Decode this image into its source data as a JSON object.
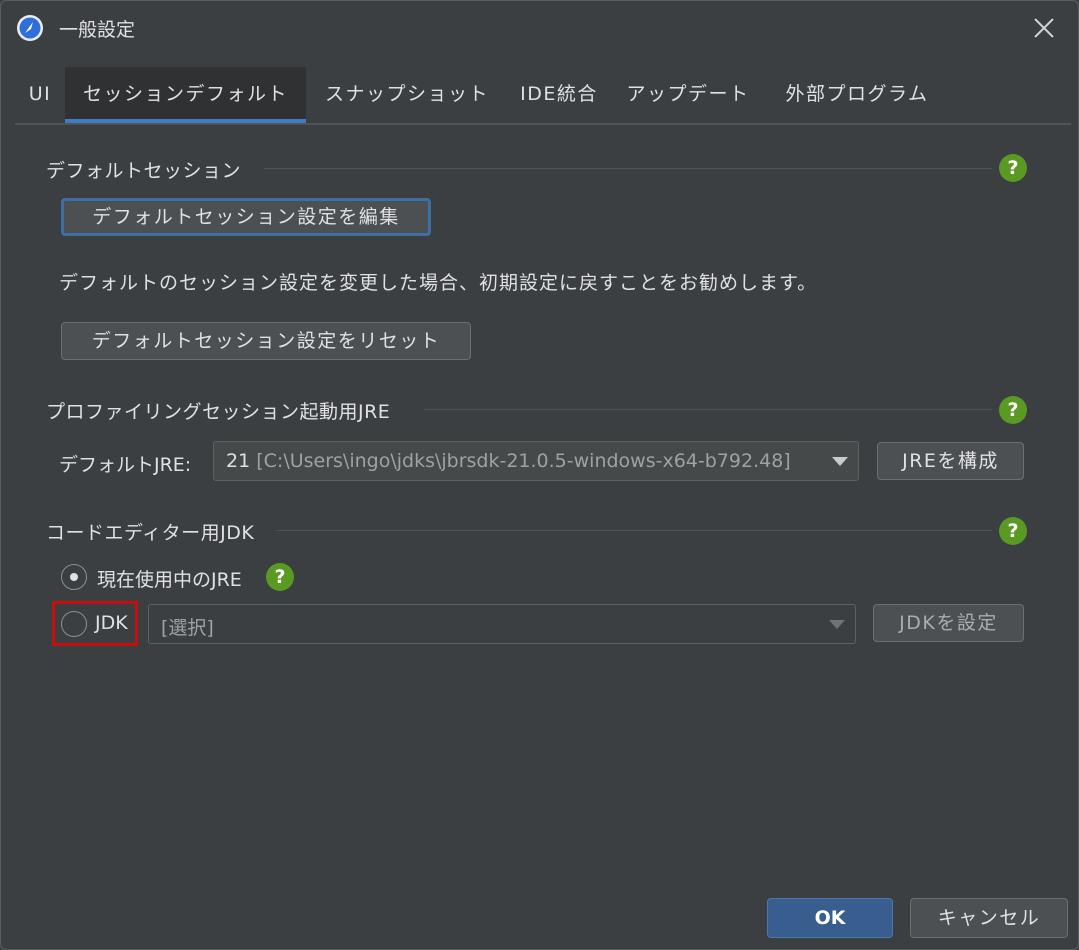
{
  "window": {
    "title": "一般設定"
  },
  "tabs": [
    {
      "label": "UI",
      "active": false
    },
    {
      "label": "セッションデフォルト",
      "active": true
    },
    {
      "label": "スナップショット",
      "active": false
    },
    {
      "label": "IDE統合",
      "active": false
    },
    {
      "label": "アップデート",
      "active": false
    },
    {
      "label": "外部プログラム",
      "active": false
    }
  ],
  "default_session": {
    "title": "デフォルトセッション",
    "edit_button": "デフォルトセッション設定を編集",
    "info": "デフォルトのセッション設定を変更した場合、初期設定に戻すことをお勧めします。",
    "reset_button": "デフォルトセッション設定をリセット"
  },
  "profiling_jre": {
    "title": "プロファイリングセッション起動用JRE",
    "label": "デフォルトJRE:",
    "selected_version": "21",
    "selected_path": "[C:\\Users\\ingo\\jdks\\jbrsdk-21.0.5-windows-x64-b792.48]",
    "configure_button": "JREを構成"
  },
  "code_editor_jdk": {
    "title": "コードエディター用JDK",
    "option_current": "現在使用中のJRE",
    "option_jdk": "JDK",
    "jdk_placeholder": "[選択]",
    "set_jdk_button": "JDKを設定"
  },
  "footer": {
    "ok": "OK",
    "cancel": "キャンセル"
  },
  "help": {
    "glyph": "?"
  },
  "colors": {
    "background": "#3c3f41",
    "accent": "#3d7dc8",
    "help": "#5a9a23",
    "highlight": "#c50f0f"
  }
}
